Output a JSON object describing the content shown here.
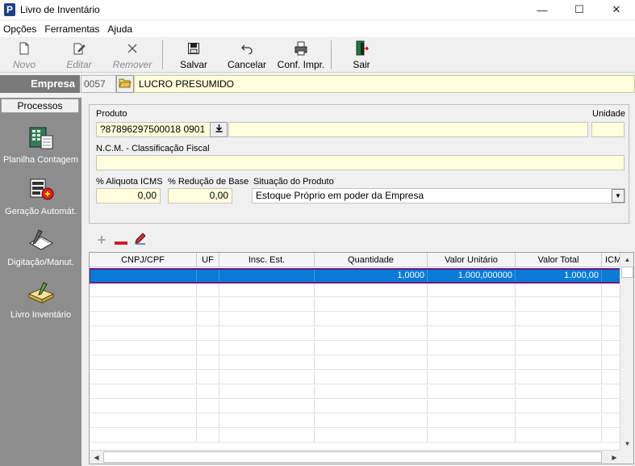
{
  "window": {
    "title": "Livro de Inventário",
    "app_icon_letter": "P",
    "minimize_glyph": "—",
    "maximize_glyph": "☐",
    "close_glyph": "✕"
  },
  "menu": [
    "Opções",
    "Ferramentas",
    "Ajuda"
  ],
  "toolbar": {
    "novo": "Novo",
    "editar": "Editar",
    "remover": "Remover",
    "salvar": "Salvar",
    "cancelar": "Cancelar",
    "conf_impr": "Conf. Impr.",
    "sair": "Sair"
  },
  "empresa": {
    "label": "Empresa",
    "code": "0057",
    "name": "LUCRO PRESUMIDO"
  },
  "sidebar": {
    "header": "Processos",
    "items": [
      {
        "label": "Planilha Contagem",
        "icon": "spreadsheet-calculator-icon"
      },
      {
        "label": "Geração Automát.",
        "icon": "automatic-generation-icon"
      },
      {
        "label": "Digitação/Manut.",
        "icon": "typing-maintenance-icon"
      },
      {
        "label": "Livro Inventário",
        "icon": "inventory-book-icon"
      }
    ]
  },
  "form": {
    "produto_label": "Produto",
    "produto_code": "?87896297500018 0901",
    "produto_desc": "",
    "unidade_label": "Unidade",
    "unidade_value": "",
    "ncm_label": "N.C.M. - Classificação Fiscal",
    "ncm_value": "",
    "aliquota_label": "% Aliquota ICMS",
    "aliquota_value": "0,00",
    "reducao_label": "% Redução de Base",
    "reducao_value": "0,00",
    "situacao_label": "Situação do Produto",
    "situacao_value": "Estoque Próprio em poder da Empresa"
  },
  "grid": {
    "columns": [
      "CNPJ/CPF",
      "UF",
      "Insc. Est.",
      "Quantidade",
      "Valor Unitário",
      "Valor Total",
      "ICMS"
    ],
    "rows": [
      {
        "cnpj": "",
        "uf": "",
        "insc": "",
        "quantidade": "1,0000",
        "valor_unitario": "1.000,000000",
        "valor_total": "1.000,00",
        "icms": ""
      }
    ],
    "selected_row_color": "#0a7bd6",
    "selection_outline_color": "#6a1a84"
  }
}
